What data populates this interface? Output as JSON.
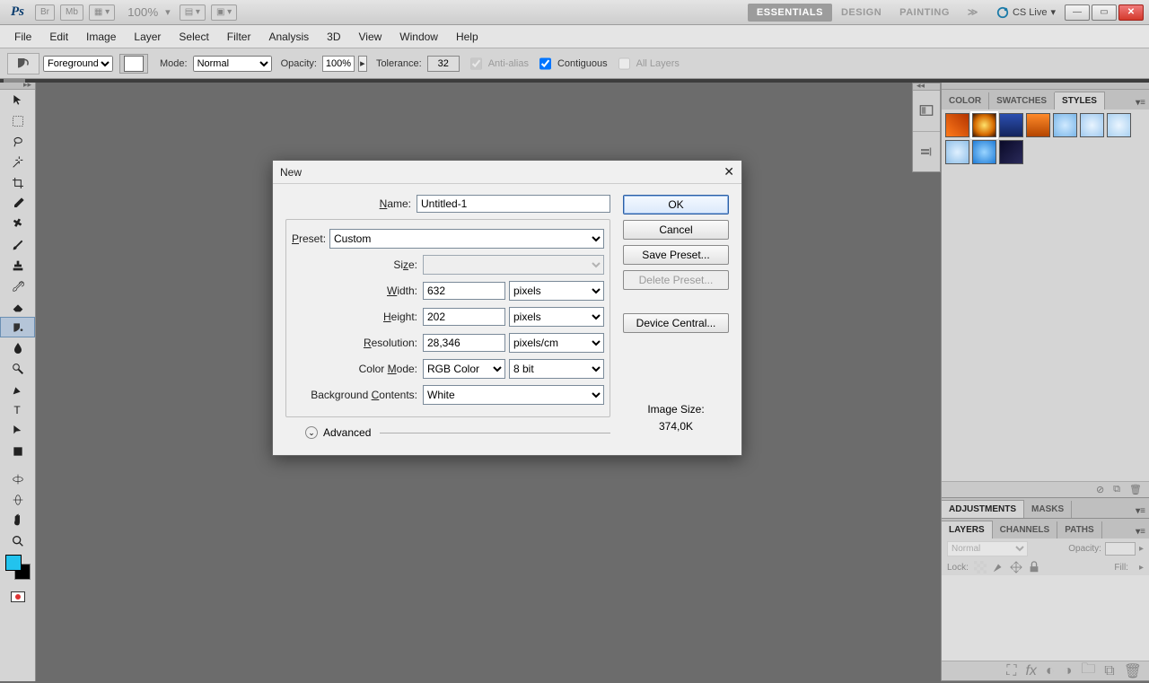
{
  "appbar": {
    "br": "Br",
    "mb": "Mb",
    "zoom": "100%",
    "workspaces": [
      "ESSENTIALS",
      "DESIGN",
      "PAINTING"
    ],
    "cslive": "CS Live"
  },
  "menu": [
    "File",
    "Edit",
    "Image",
    "Layer",
    "Select",
    "Filter",
    "Analysis",
    "3D",
    "View",
    "Window",
    "Help"
  ],
  "optbar": {
    "fill": "Foreground",
    "mode_label": "Mode:",
    "mode": "Normal",
    "opacity_label": "Opacity:",
    "opacity": "100%",
    "tolerance_label": "Tolerance:",
    "tolerance": "32",
    "antialias": "Anti-alias",
    "contiguous": "Contiguous",
    "alllayers": "All Layers"
  },
  "panels": {
    "styles": {
      "tabs": [
        "COLOR",
        "SWATCHES",
        "STYLES"
      ],
      "active": 2
    },
    "adjustments": {
      "tabs": [
        "ADJUSTMENTS",
        "MASKS"
      ],
      "active": 0
    },
    "layers": {
      "tabs": [
        "LAYERS",
        "CHANNELS",
        "PATHS"
      ],
      "active": 0,
      "blend": "Normal",
      "opacity_label": "Opacity:",
      "lock_label": "Lock:",
      "fill_label": "Fill:"
    }
  },
  "style_swatches": [
    "linear-gradient(45deg,#ff7a1a,#b33400)",
    "radial-gradient(circle,#ffe26b,#d66b00 60%,#3b1400)",
    "linear-gradient(#2b4fb0,#13245c)",
    "linear-gradient(#ff8a2a,#b34500)",
    "radial-gradient(circle,#cfe9ff,#7ab6e8)",
    "radial-gradient(circle,#e8f4ff,#9fc9ef)",
    "radial-gradient(circle,#eaf5ff,#a9d0f0)",
    "radial-gradient(circle,#dff0ff,#8fbfe8)",
    "radial-gradient(circle,#99d4ff,#1e7bd6)",
    "linear-gradient(135deg,#0a0a28,#2a2a5a)"
  ],
  "dialog": {
    "title": "New",
    "name_label": "Name:",
    "name": "Untitled-1",
    "preset_label": "Preset:",
    "preset": "Custom",
    "size_label": "Size:",
    "width_label": "Width:",
    "width": "632",
    "width_unit": "pixels",
    "height_label": "Height:",
    "height": "202",
    "height_unit": "pixels",
    "resolution_label": "Resolution:",
    "resolution": "28,346",
    "res_unit": "pixels/cm",
    "colormode_label": "Color Mode:",
    "colormode": "RGB Color",
    "bitdepth": "8 bit",
    "bgcontents_label": "Background Contents:",
    "bgcontents": "White",
    "advanced": "Advanced",
    "ok": "OK",
    "cancel": "Cancel",
    "save_preset": "Save Preset...",
    "delete_preset": "Delete Preset...",
    "device_central": "Device Central...",
    "imagesize_label": "Image Size:",
    "imagesize": "374,0K"
  }
}
